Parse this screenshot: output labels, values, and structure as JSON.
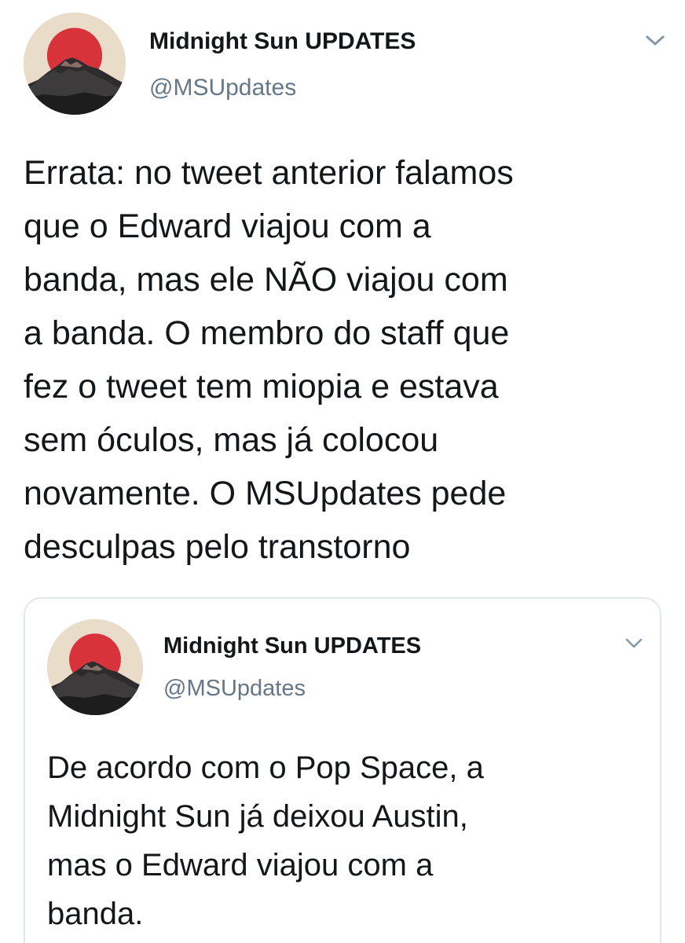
{
  "tweet": {
    "display_name": "Midnight Sun UPDATES",
    "handle": "@MSUpdates",
    "text": "Errata: no tweet anterior falamos\nque o Edward viajou com a\nbanda, mas ele NÃO viajou com\na banda. O membro do staff que\nfez o tweet tem miopia e estava\nsem óculos, mas já colocou\nnovamente. O MSUpdates pede\ndesculpas pelo transtorno",
    "avatar_icon": "sunset-mountain-avatar",
    "menu_icon": "chevron-down-icon"
  },
  "quoted_tweet": {
    "display_name": "Midnight Sun UPDATES",
    "handle": "@MSUpdates",
    "text": "De acordo com o Pop Space, a\nMidnight Sun já deixou Austin,\nmas o Edward viajou com a\nbanda.",
    "avatar_icon": "sunset-mountain-avatar",
    "menu_icon": "chevron-down-icon"
  },
  "colors": {
    "text": "#14171a",
    "secondary_text": "#657786",
    "border": "#e1e8ed",
    "avatar_sun": "#d8323a",
    "avatar_background": "#e9dcc9"
  }
}
